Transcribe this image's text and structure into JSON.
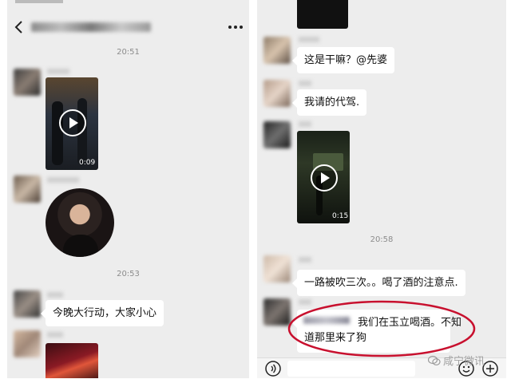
{
  "left_chat": {
    "header": {
      "back_icon": "chevron-left-icon",
      "title": "",
      "more_icon": "more-dots-icon"
    },
    "time_1": "20:51",
    "video_1": {
      "duration": "0:09"
    },
    "time_2": "20:53",
    "message_1": "今晚大行动，大家小心"
  },
  "right_chat": {
    "message_1": "这是干嘛？@先婆",
    "message_2": "我请的代驾.",
    "video_1": {
      "duration": "0:15"
    },
    "time_1": "20:58",
    "message_3": "一路被吹三次。。喝了酒的注意点.",
    "message_4_line1": "我们在玉立喝酒。不知",
    "message_4_line2": "道那里来了狗",
    "input_bar": {
      "voice_icon": "voice-icon",
      "emoji_icon": "emoji-icon",
      "plus_icon": "plus-icon"
    },
    "watermark": "咸宁微讯"
  },
  "colors": {
    "background": "#ededed",
    "bubble": "#ffffff",
    "highlight_ellipse": "#c8102e"
  }
}
